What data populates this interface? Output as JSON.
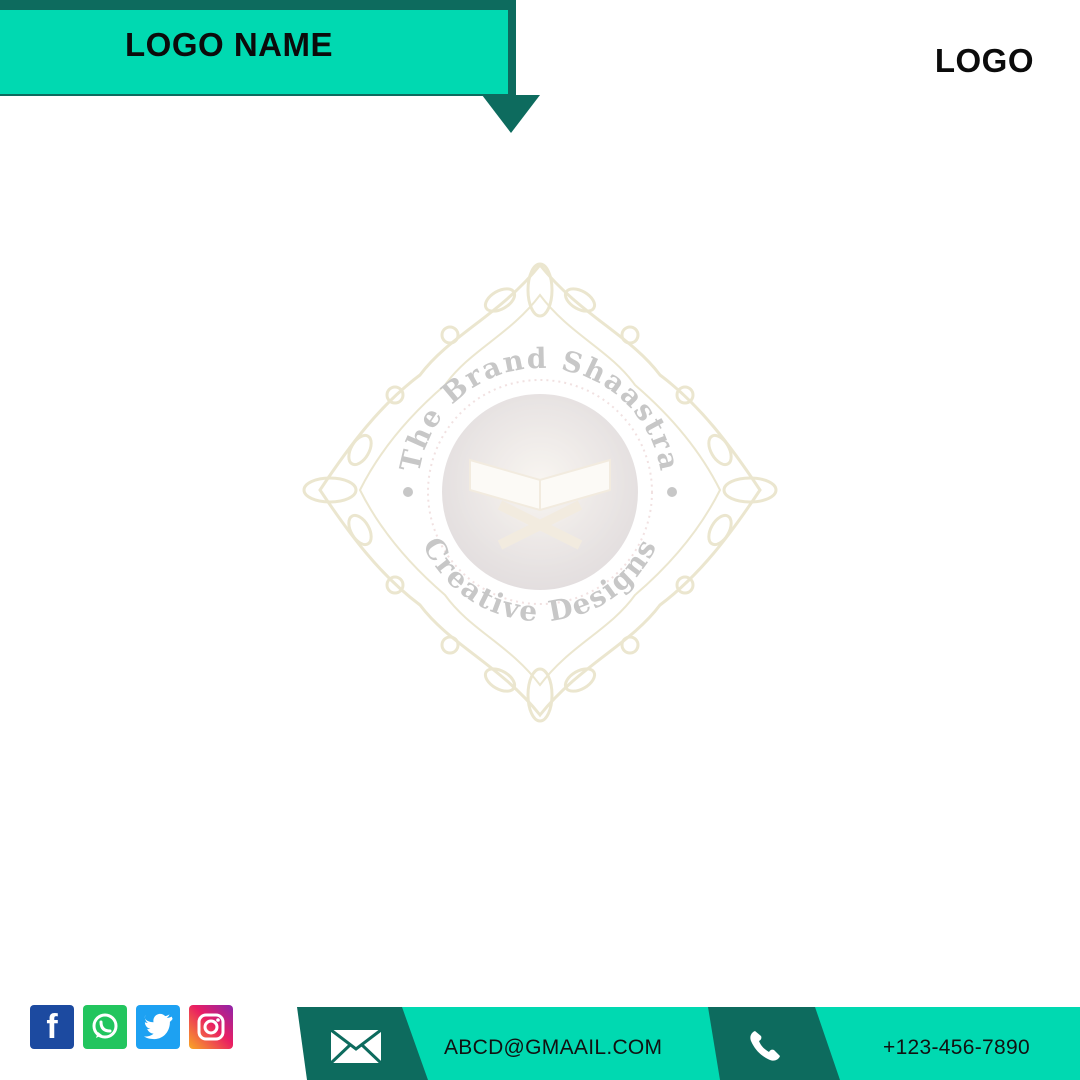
{
  "header": {
    "logo_name": "LOGO NAME",
    "logo": "LOGO"
  },
  "watermark": {
    "top_text": "The Brand Shaastra",
    "bottom_text": "Creative Designs"
  },
  "socials": [
    {
      "icon": "facebook-icon",
      "color": "#1c4aa0"
    },
    {
      "icon": "whatsapp-icon",
      "color": "#22c55e"
    },
    {
      "icon": "twitter-icon",
      "color": "#1da1f2"
    },
    {
      "icon": "instagram-icon",
      "color": "#e91e63"
    }
  ],
  "contact": {
    "email": "ABCD@GMAAIL.COM",
    "email_icon": "envelope-icon",
    "phone": "+123-456-7890",
    "phone_icon": "phone-icon"
  },
  "colors": {
    "accent": "#00d9b1",
    "dark": "#0d6b5e"
  }
}
